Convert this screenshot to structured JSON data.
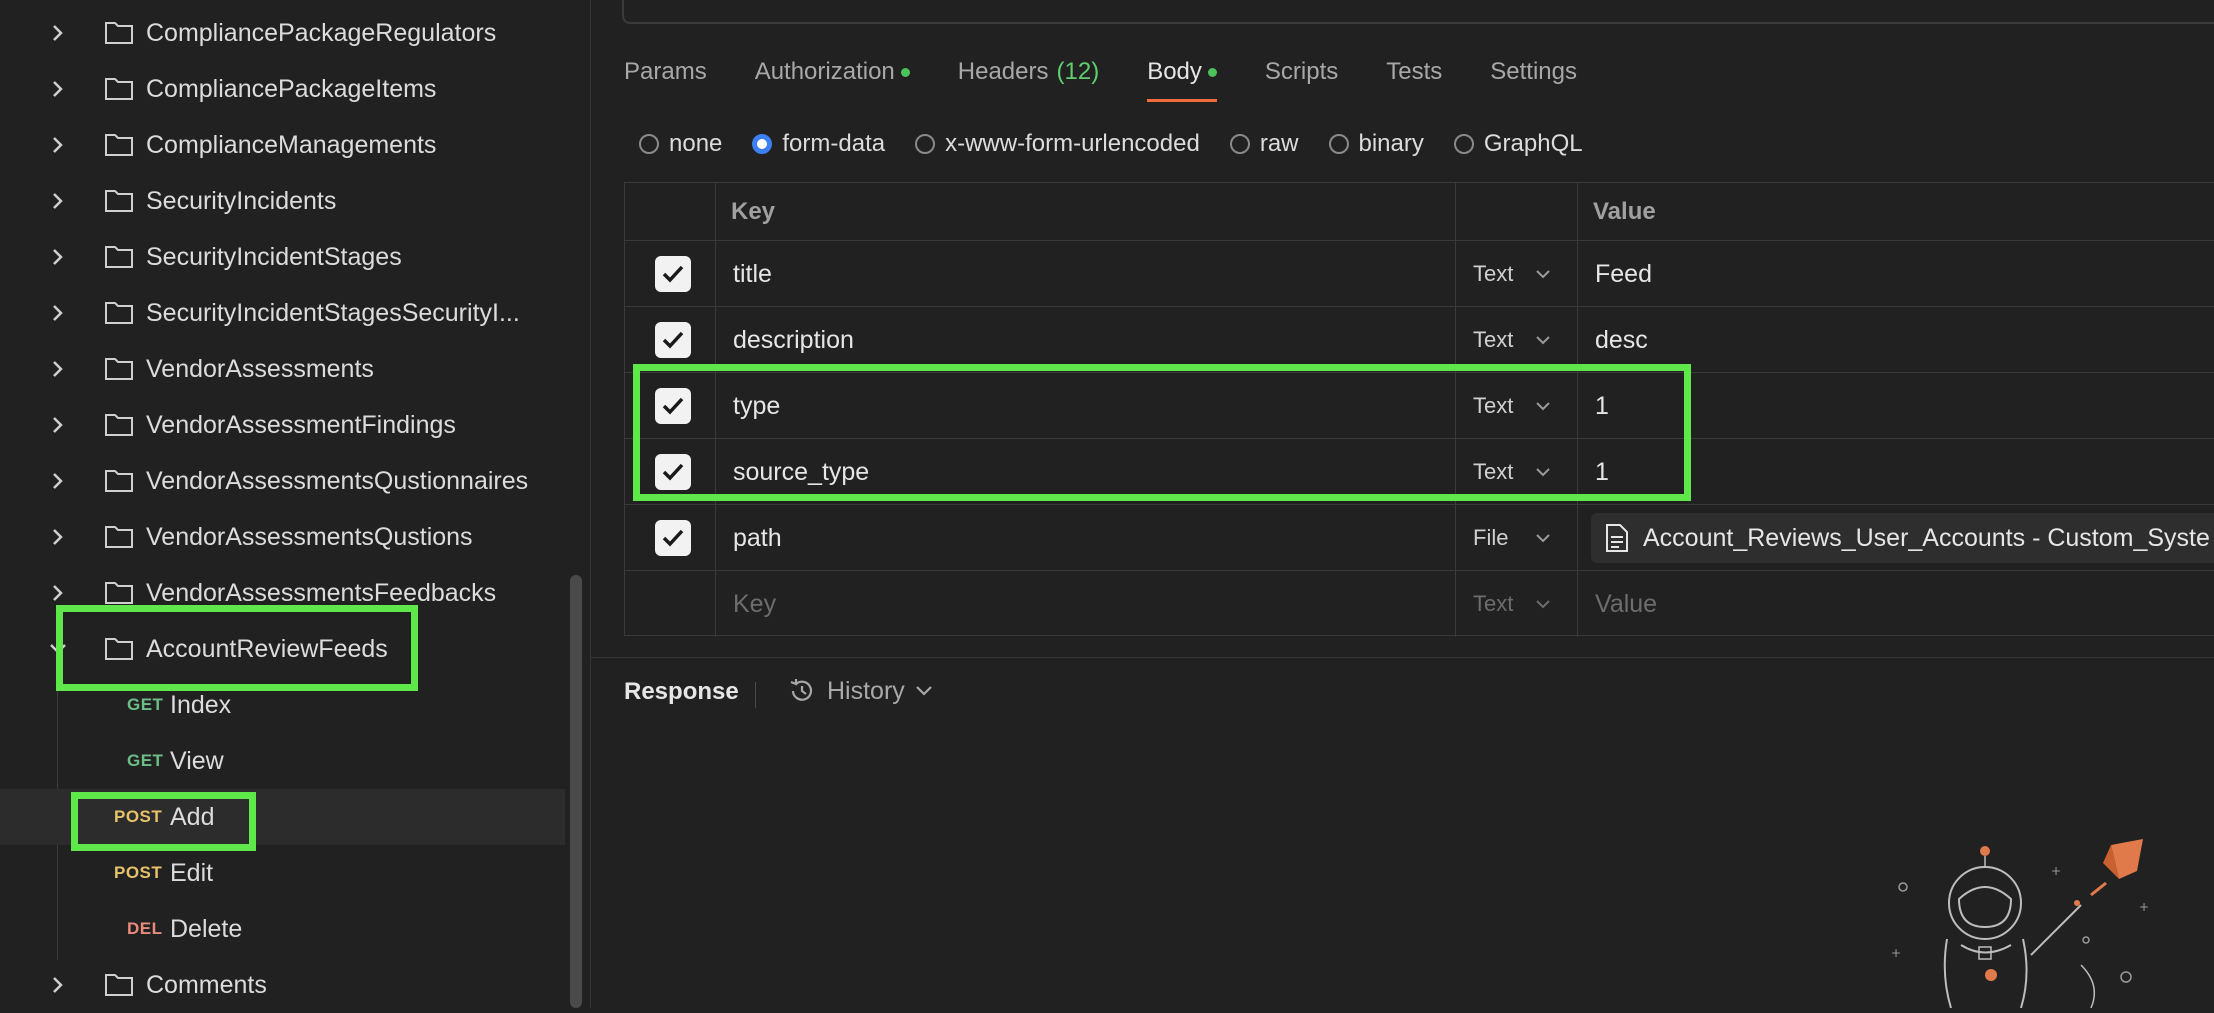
{
  "sidebar": {
    "folders_top": [
      {
        "label": "CompliancePackageRegulators"
      },
      {
        "label": "CompliancePackageItems"
      },
      {
        "label": "ComplianceManagements"
      },
      {
        "label": "SecurityIncidents"
      },
      {
        "label": "SecurityIncidentStages"
      },
      {
        "label": "SecurityIncidentStagesSecurityI..."
      },
      {
        "label": "VendorAssessments"
      },
      {
        "label": "VendorAssessmentFindings"
      },
      {
        "label": "VendorAssessmentsQustionnaires"
      },
      {
        "label": "VendorAssessmentsQustions"
      },
      {
        "label": "VendorAssessmentsFeedbacks"
      }
    ],
    "open_folder": {
      "label": "AccountReviewFeeds"
    },
    "requests": [
      {
        "method": "GET",
        "label": "Index"
      },
      {
        "method": "GET",
        "label": "View"
      },
      {
        "method": "POST",
        "label": "Add"
      },
      {
        "method": "POST",
        "label": "Edit"
      },
      {
        "method": "DEL",
        "label": "Delete"
      }
    ],
    "folder_after": {
      "label": "Comments"
    }
  },
  "tabs": [
    {
      "label": "Params"
    },
    {
      "label": "Authorization"
    },
    {
      "label": "Headers",
      "count": "(12)"
    },
    {
      "label": "Body"
    },
    {
      "label": "Scripts"
    },
    {
      "label": "Tests"
    },
    {
      "label": "Settings"
    }
  ],
  "body_modes": [
    {
      "label": "none",
      "selected": false
    },
    {
      "label": "form-data",
      "selected": true
    },
    {
      "label": "x-www-form-urlencoded",
      "selected": false
    },
    {
      "label": "raw",
      "selected": false
    },
    {
      "label": "binary",
      "selected": false
    },
    {
      "label": "GraphQL",
      "selected": false
    }
  ],
  "table": {
    "header_key": "Key",
    "header_value": "Value",
    "rows": [
      {
        "key": "title",
        "type": "Text",
        "value": "Feed"
      },
      {
        "key": "description",
        "type": "Text",
        "value": "desc"
      },
      {
        "key": "type",
        "type": "Text",
        "value": "1"
      },
      {
        "key": "source_type",
        "type": "Text",
        "value": "1"
      },
      {
        "key": "path",
        "type": "File",
        "value": "Account_Reviews_User_Accounts - Custom_Syste"
      }
    ],
    "placeholder": {
      "key": "Key",
      "type": "Text",
      "value": "Value"
    }
  },
  "response": {
    "title": "Response",
    "history_label": "History"
  },
  "colors": {
    "highlight": "#5ee84a",
    "accent_tab": "#f26b3a",
    "radio_selected": "#3d7ef0",
    "method_get": "#6bbf86",
    "method_post": "#e8c26b",
    "method_del": "#e88b7c"
  },
  "icons": [
    "chevron-right-icon",
    "chevron-down-icon",
    "folder-icon",
    "checkbox-checked-icon",
    "dropdown-chevron-icon",
    "file-icon",
    "history-icon",
    "astronaut-illustration"
  ]
}
